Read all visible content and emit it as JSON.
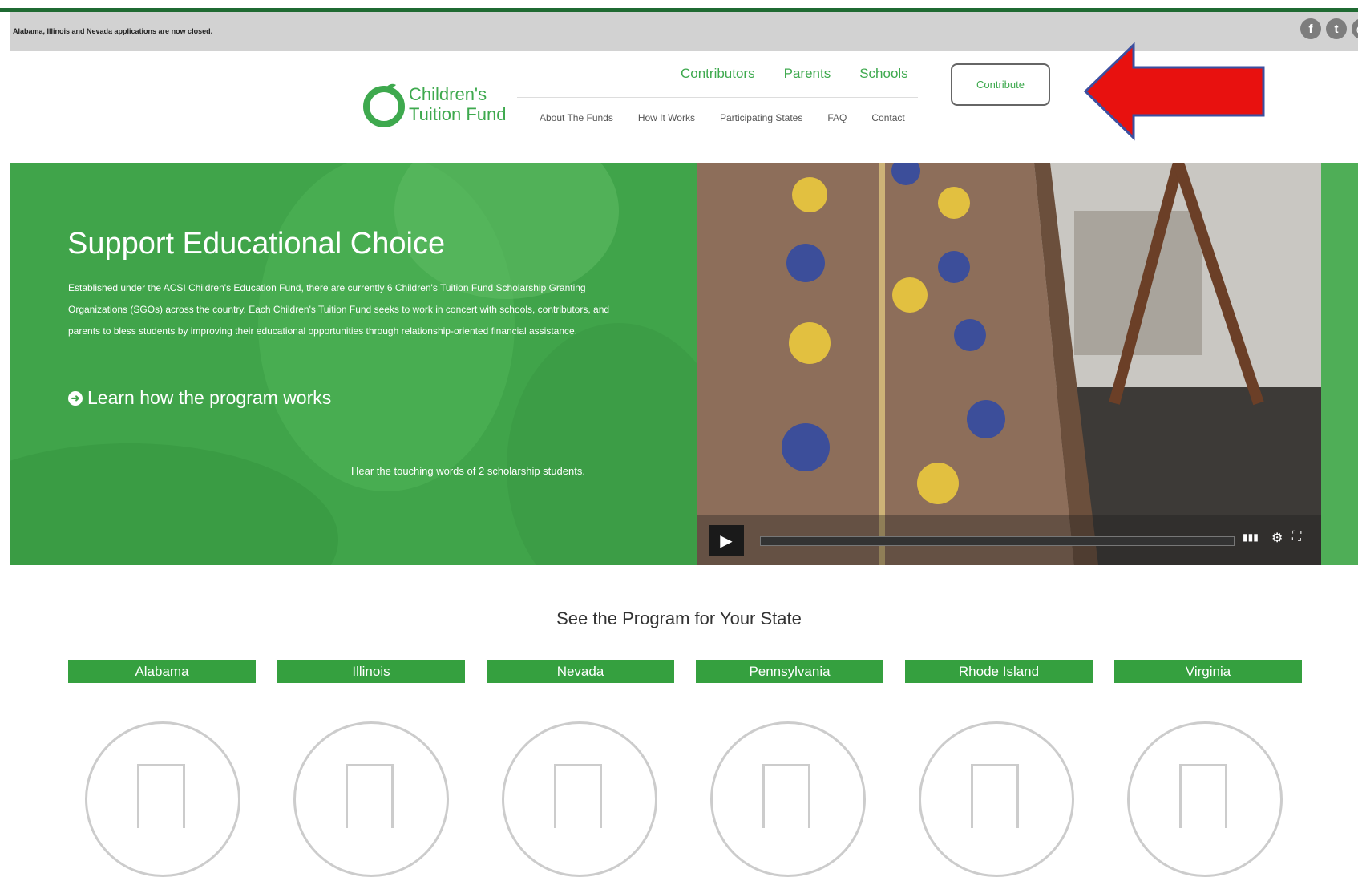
{
  "notice": {
    "text": "Alabama, Illinois and Nevada applications are now closed."
  },
  "social": [
    "f",
    "t",
    "@"
  ],
  "logo": {
    "line1": "Children's",
    "line2": "Tuition Fund"
  },
  "nav": {
    "primary": [
      "Contributors",
      "Parents",
      "Schools"
    ],
    "secondary": [
      "About The Funds",
      "How It Works",
      "Participating States",
      "FAQ",
      "Contact"
    ],
    "contribute_label": "Contribute"
  },
  "hero": {
    "title": "Support Educational Choice",
    "text": "Established under the ACSI Children's Education Fund, there are currently 6 Children's Tuition Fund Scholarship Granting Organizations (SGOs) across the country. Each Children's Tuition Fund seeks to work in concert with schools, contributors, and parents to bless students by improving their educational opportunities through relationship-oriented financial assistance.",
    "link": "Learn how the program works",
    "caption": "Hear the touching words of 2 scholarship students."
  },
  "states": {
    "heading": "See the Program for Your State",
    "items": [
      "Alabama",
      "Illinois",
      "Nevada",
      "Pennsylvania",
      "Rhode Island",
      "Virginia"
    ]
  },
  "colors": {
    "brand_green": "#3ea94e",
    "hero_green": "#40a44a",
    "annotation_red": "#e8110f"
  }
}
